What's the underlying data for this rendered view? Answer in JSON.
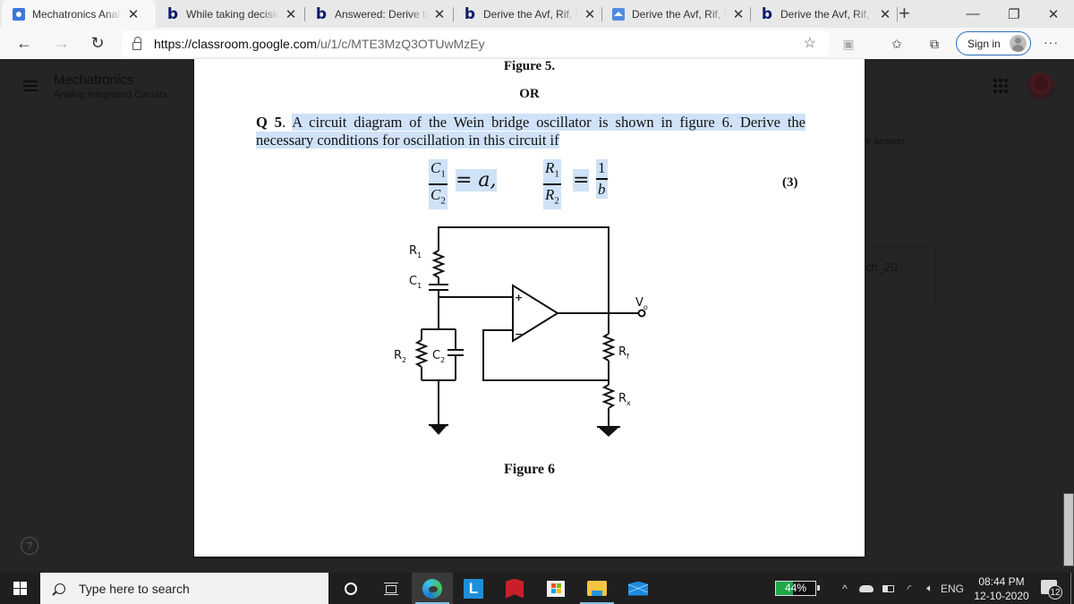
{
  "browser": {
    "tabs": [
      {
        "title": "Mechatronics Analog Integrated Circuits",
        "favicon": "google-classroom-icon",
        "active": true
      },
      {
        "title": "While taking decision",
        "favicon": "bartleby-icon",
        "active": false
      },
      {
        "title": "Answered: Derive the",
        "favicon": "bartleby-icon",
        "active": false
      },
      {
        "title": "Derive the Avf, Rif, Ro",
        "favicon": "bartleby-icon",
        "active": false
      },
      {
        "title": "Derive the Avf, Rif, Ro",
        "favicon": "shared-doc-icon",
        "active": false
      },
      {
        "title": "Derive the Avf, Rif, Ro",
        "favicon": "bartleby-icon",
        "active": false
      }
    ],
    "new_tab": "+",
    "window_controls": {
      "minimize": "—",
      "restore": "❐",
      "close": "✕"
    },
    "tab_close": "✕",
    "url_host": "https://classroom.google.com",
    "url_path": "/u/1/c/MTE3MzQ3OTUwMzEy",
    "sign_in_label": "Sign in",
    "more_label": "···"
  },
  "classroom": {
    "class_name": "Mechatronics",
    "section": "Analog Integrated Circuits",
    "behind_text": "e answer-",
    "attachment_text": "ch_20...",
    "help": "?"
  },
  "viewer": {
    "figure5_caption": "Figure 5.",
    "or_label": "OR",
    "question_number": "Q 5",
    "question_text": "A circuit diagram of the Wein bridge oscillator is shown in figure 6. Derive the necessary conditions for oscillation in this circuit if",
    "equation": {
      "frac1_num": "C",
      "frac1_num_sub": "1",
      "frac1_den": "C",
      "frac1_den_sub": "2",
      "eq1_rhs": "= a,",
      "frac2_num": "R",
      "frac2_num_sub": "1",
      "frac2_den": "R",
      "frac2_den_sub": "2",
      "eq2_sign": "=",
      "frac3_num": "1",
      "frac3_den": "b"
    },
    "marks": "(3)",
    "circuit_labels": {
      "r1": "R",
      "r1_sub": "1",
      "c1": "C",
      "c1_sub": "1",
      "r2": "R",
      "r2_sub": "2",
      "c2": "C",
      "c2_sub": "2",
      "rf": "R",
      "rf_sub": "f",
      "rx": "R",
      "rx_sub": "x",
      "vo": "V",
      "vo_sub": "o",
      "plus": "+",
      "minus": "−"
    },
    "figure6_caption": "Figure 6"
  },
  "taskbar": {
    "search_placeholder": "Type here to search",
    "battery_percent": 44,
    "battery_label": "44%",
    "language": "ENG",
    "time": "08:44 PM",
    "date": "12-10-2020",
    "notification_count": "12"
  }
}
